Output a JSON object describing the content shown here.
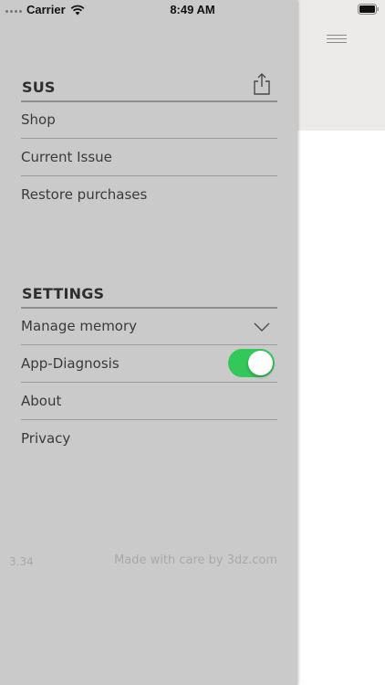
{
  "status_bar": {
    "carrier": "Carrier",
    "time": "8:49 AM"
  },
  "sections": {
    "sus": {
      "title": "SUS",
      "items": [
        {
          "label": "Shop"
        },
        {
          "label": "Current Issue"
        },
        {
          "label": "Restore purchases"
        }
      ]
    },
    "settings": {
      "title": "SETTINGS",
      "items": [
        {
          "label": "Manage memory"
        },
        {
          "label": "App-Diagnosis",
          "toggle_on": true
        },
        {
          "label": "About"
        },
        {
          "label": "Privacy"
        }
      ]
    }
  },
  "footer": {
    "version": "3.34",
    "credit": "Made with care by 3dz.com"
  },
  "colors": {
    "drawer_bg": "#cacaca",
    "toggle_on": "#34c759",
    "header_bg": "#ecebe9"
  },
  "icons": {
    "share": "share-icon",
    "chevron": "chevron-down-icon",
    "menu": "hamburger-menu-icon",
    "wifi": "wifi-icon",
    "battery": "battery-icon"
  }
}
